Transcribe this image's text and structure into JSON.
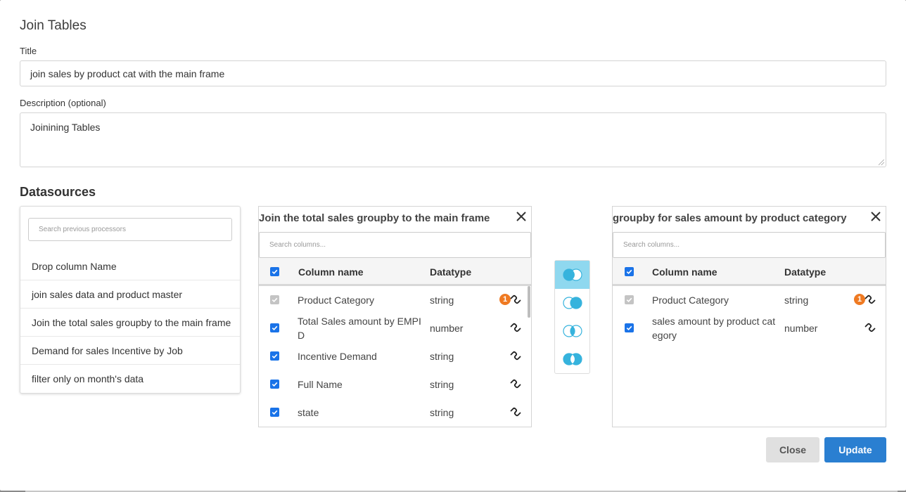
{
  "modal": {
    "title": "Join Tables",
    "title_label": "Title",
    "title_value": "join sales by product cat with the main frame",
    "description_label": "Description (optional)",
    "description_value": "Joinining Tables"
  },
  "datasources": {
    "heading": "Datasources",
    "search_placeholder": "Search previous processors",
    "processors": [
      "Drop column Name",
      "join sales data and product master",
      "Join the total sales groupby to the main frame",
      "Demand for sales Incentive by Job",
      "filter only on month's data"
    ]
  },
  "left_table": {
    "title": "Join the total sales groupby to the main frame",
    "search_placeholder": "Search columns...",
    "col_name_header": "Column name",
    "datatype_header": "Datatype",
    "rows": [
      {
        "name": "Product Category",
        "type": "string",
        "badge": "1"
      },
      {
        "name": "Total Sales amount by EMPI\nD",
        "type": "number"
      },
      {
        "name": "Incentive Demand",
        "type": "string"
      },
      {
        "name": "Full Name",
        "type": "string"
      },
      {
        "name": "state",
        "type": "string"
      }
    ]
  },
  "right_table": {
    "title": "groupby for sales amount by product category",
    "search_placeholder": "Search columns...",
    "col_name_header": "Column name",
    "datatype_header": "Datatype",
    "rows": [
      {
        "name": "Product Category",
        "type": "string",
        "badge": "1"
      },
      {
        "name": "sales amount by product cat\negory",
        "type": "number"
      }
    ]
  },
  "join_types": {
    "selected": "left-join",
    "colors": {
      "accent": "#36b3dd",
      "active_bg": "#8fd8ef"
    }
  },
  "footer": {
    "close_label": "Close",
    "update_label": "Update"
  },
  "colors": {
    "primary": "#2a7fd1",
    "checkbox": "#1a73e8",
    "badge": "#ef7a22"
  }
}
